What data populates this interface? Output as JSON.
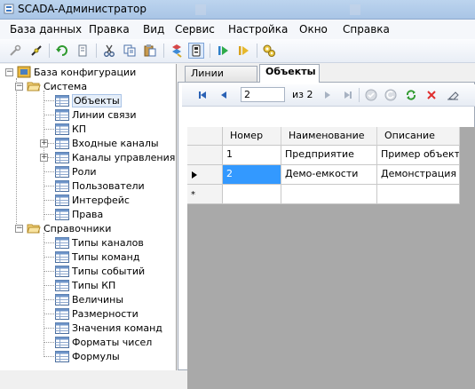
{
  "window": {
    "title": "SCADA-Администратор"
  },
  "menu": [
    "База данных",
    "Правка",
    "Вид",
    "Сервис",
    "Настройка",
    "Окно",
    "Справка"
  ],
  "toolbar": {
    "icons": [
      "connect-icon",
      "disconnect-icon",
      "refresh-icon",
      "save-icon",
      "cut-icon",
      "copy-icon",
      "paste-icon",
      "find-icon",
      "property-icon",
      "start-icon",
      "restart-icon",
      "settings-icon"
    ]
  },
  "tree": {
    "root": "База конфигурации",
    "system": {
      "label": "Система",
      "items": [
        "Объекты",
        "Линии связи",
        "КП",
        "Входные каналы",
        "Каналы управления",
        "Роли",
        "Пользователи",
        "Интерфейс",
        "Права"
      ]
    },
    "references": {
      "label": "Справочники",
      "items": [
        "Типы каналов",
        "Типы команд",
        "Типы событий",
        "Типы КП",
        "Величины",
        "Размерности",
        "Значения команд",
        "Форматы чисел",
        "Формулы"
      ]
    }
  },
  "tabs": [
    "Линии связи",
    "Объекты"
  ],
  "navigator": {
    "position": "2",
    "of_label": "из 2"
  },
  "table": {
    "columns": [
      "Номер",
      "Наименование",
      "Описание"
    ],
    "rows": [
      [
        "1",
        "Предприятие",
        "Пример объекта"
      ],
      [
        "2",
        "Демо-емкости",
        "Демонстрация"
      ]
    ],
    "new_row_marker": "*"
  }
}
